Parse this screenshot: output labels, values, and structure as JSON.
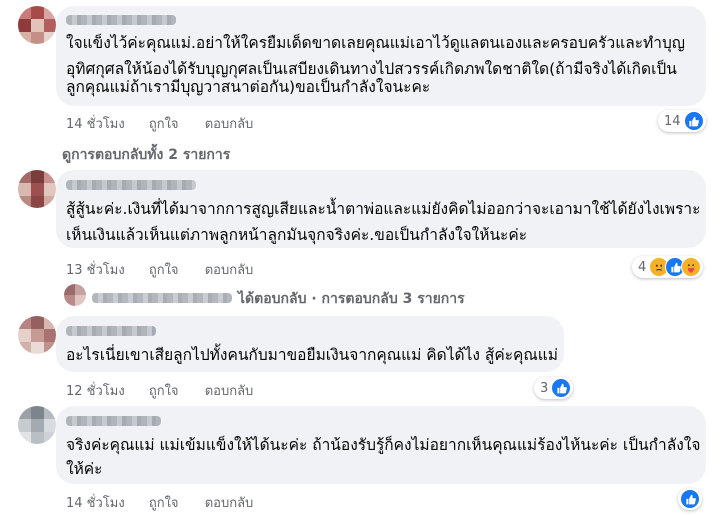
{
  "comments": [
    {
      "lines": [
        "ใจแข็งไว้ค่ะคุณแม่.อย่าให้ใครยืมเด็ดขาดเลยคุณแม่เอาไว้ดูแลตนเองและครอบครัวและทำบุญ",
        "อุทิศกุศลให้น้องได้รับบุญกุศลเป็นเสบียงเดินทางไปสวรรค์เกิดภพใดชาติใด(ถ้ามีจริงได้เกิดเป็น",
        "ลูกคุณแม่ถ้าเรามีบุญวาสนาต่อกัน)ขอเป็นกำลังใจนะคะ"
      ],
      "time": "14 ชั่วโมง",
      "like": "ถูกใจ",
      "reply": "ตอบกลับ",
      "reaction_count": "14"
    },
    {
      "lines": [
        "สู้สู้นะค่ะ.เงินที่ได้มาจากการสูญเสียและน้ำตาพ่อและแม่ยังคิดไม่ออกว่าจะเอามาใช้ได้ยังไงเพราะ",
        "เห็นเงินแล้วเห็นแต่ภาพลูกหน้าลูกมันจุกจริงค่ะ.ขอเป็นกำลังใจให้นะค่ะ"
      ],
      "time": "13 ชั่วโมง",
      "like": "ถูกใจ",
      "reply": "ตอบกลับ",
      "reaction_count": "4"
    },
    {
      "lines": [
        "อะไรเนี่ยเขาเสียลูกไปทั้งคนกับมาขอยืมเงินจากคุณแม่ คิดได้ไง สู้ค่ะคุณแม่"
      ],
      "time": "12 ชั่วโมง",
      "like": "ถูกใจ",
      "reply": "ตอบกลับ",
      "reaction_count": "3"
    },
    {
      "lines": [
        "จริงค่ะคุณแม่ แม่เข้มแข็งให้ได้นะค่ะ ถ้าน้องรับรู้ก็คงไม่อยากเห็นคุณแม่ร้องไห้นะค่ะ เป็นกำลังใจ",
        "ให้ค่ะ"
      ],
      "time": "14 ชั่วโมง",
      "like": "ถูกใจ",
      "reply": "ตอบกลับ",
      "reaction_count": ""
    }
  ],
  "view_replies": "ดูการตอบกลับทั้ง 2 รายการ",
  "reply_summary": "ได้ตอบกลับ · การตอบกลับ 3 รายการ",
  "colors": {
    "bubble": "#f0f2f5",
    "meta": "#65676b",
    "like_blue": "#1877f2",
    "emoji_yellow": "#f7b125"
  },
  "icons": [
    "like-icon",
    "sad-icon",
    "care-icon"
  ]
}
